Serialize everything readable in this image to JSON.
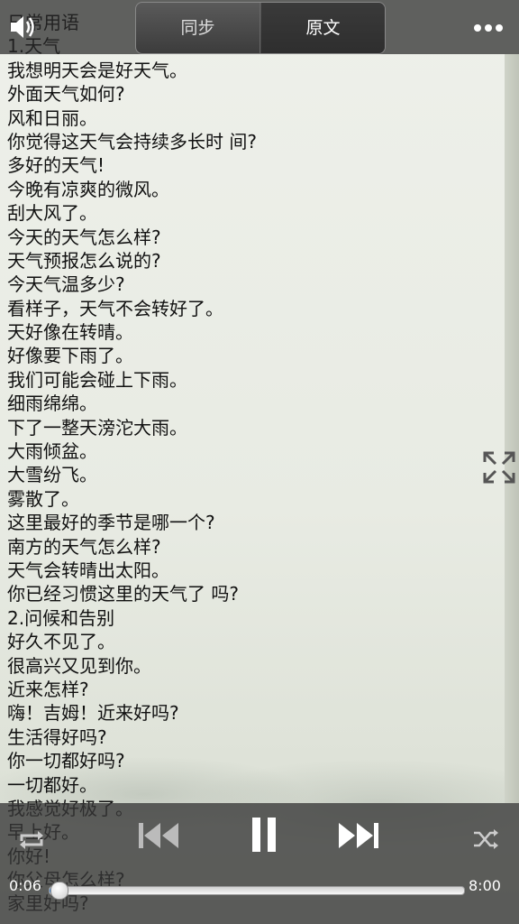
{
  "header": {
    "tab_sync": "同步",
    "tab_original": "原文"
  },
  "content_lines": [
    "日常用语",
    "1.天气",
    "我想明天会是好天气。",
    "外面天气如何?",
    "风和日丽。",
    "你觉得这天气会持续多长时 间?",
    "多好的天气!",
    "今晚有凉爽的微风。",
    "刮大风了。",
    "今天的天气怎么样?",
    "天气预报怎么说的?",
    "今天气温多少?",
    "看样子，天气不会转好了。",
    "天好像在转晴。",
    "好像要下雨了。",
    "我们可能会碰上下雨。",
    "细雨绵绵。",
    "下了一整天滂沱大雨。",
    "大雨倾盆。",
    "大雪纷飞。",
    "雾散了。",
    "这里最好的季节是哪一个?",
    "南方的天气怎么样?",
    "天气会转晴出太阳。",
    "你已经习惯这里的天气了 吗?",
    "2.问候和告别",
    "好久不见了。",
    "很高兴又见到你。",
    "近来怎样?",
    "嗨！吉姆！近来好吗?",
    "生活得好吗?",
    "你一切都好吗?",
    "一切都好。",
    "我感觉好极了。",
    "早上好。",
    "你好!",
    "你父母怎么样?",
    "家里好吗?"
  ],
  "player": {
    "current_time": "0:06",
    "total_time": "8:00",
    "progress": 0.0125
  },
  "icons": {
    "speaker": "speaker-icon",
    "menu": "menu-dots-icon",
    "expand": "expand-icon",
    "repeat": "repeat-icon",
    "previous": "previous-track-icon",
    "pause": "pause-icon",
    "next": "next-track-icon",
    "shuffle": "shuffle-icon"
  }
}
